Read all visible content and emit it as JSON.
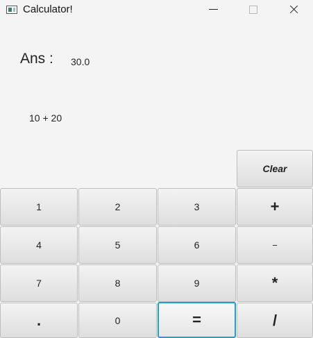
{
  "window": {
    "title": "Calculator!",
    "icon": "app-window-icon",
    "controls": [
      "minimize-icon",
      "maximize-icon",
      "close-icon"
    ]
  },
  "display": {
    "ans_label": "Ans :",
    "ans_value": "30.0",
    "expression": "10 + 20"
  },
  "keys": {
    "clear": "Clear",
    "one": "1",
    "two": "2",
    "three": "3",
    "plus": "+",
    "four": "4",
    "five": "5",
    "six": "6",
    "minus": "−",
    "seven": "7",
    "eight": "8",
    "nine": "9",
    "multiply": "*",
    "dot": ".",
    "zero": "0",
    "equals": "=",
    "divide": "/"
  },
  "colors": {
    "focus_ring": "#1a9fd6",
    "background": "#f4f4f4"
  }
}
